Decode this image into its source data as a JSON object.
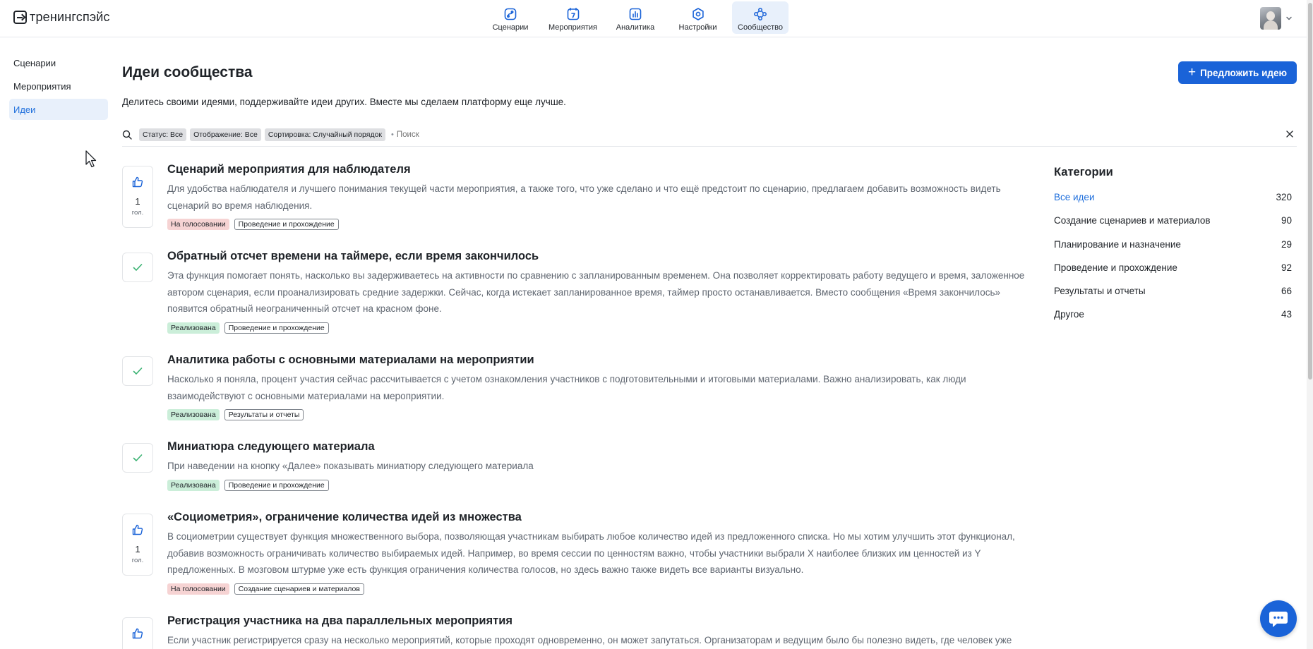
{
  "header": {
    "logo_text": "тренингспэйс",
    "nav": [
      {
        "label": "Сценарии",
        "icon": "scenario-icon"
      },
      {
        "label": "Мероприятия",
        "icon": "calendar-icon"
      },
      {
        "label": "Аналитика",
        "icon": "analytics-icon"
      },
      {
        "label": "Настройки",
        "icon": "settings-icon"
      },
      {
        "label": "Сообщество",
        "icon": "community-icon",
        "active": true
      }
    ]
  },
  "sidebar": {
    "items": [
      {
        "label": "Сценарии"
      },
      {
        "label": "Мероприятия"
      },
      {
        "label": "Идеи",
        "active": true
      }
    ]
  },
  "main": {
    "title": "Идеи сообщества",
    "subtitle": "Делитесь своими идеями, поддерживайте идеи других. Вместе мы сделаем платформу еще лучше.",
    "propose_button": "Предложить идею",
    "filters": {
      "chips": [
        "Статус: Все",
        "Отображение: Все",
        "Сортировка: Случайный порядок"
      ],
      "search_placeholder": "Поиск"
    },
    "ideas": [
      {
        "title": "Сценарий мероприятия для наблюдателя",
        "description": "Для удобства наблюдателя и лучшего понимания текущей части мероприятия, а также того, что уже сделано и что ещё предстоит по сценарию, предлагаем добавить возможность видеть сценарий во время наблюдения.",
        "status": "На голосовании",
        "category": "Проведение и прохождение",
        "votes": "1",
        "votes_unit": "гол."
      },
      {
        "title": "Обратный отсчет времени на таймере, если время закончилось",
        "description": "Эта функция помогает понять, насколько вы задерживаетесь на активности по сравнению с запланированным временем. Она позволяет корректировать работу ведущего и время, заложенное автором сценария, если проанализировать средние задержки. Сейчас, когда истекает запланированное время, таймер просто останавливается. Вместо сообщения «Время закончилось» появится обратный неограниченный отсчет на красном фоне.",
        "status": "Реализована",
        "category": "Проведение и прохождение"
      },
      {
        "title": "Аналитика работы с основными материалами на мероприятии",
        "description": "Насколько я поняла, процент участия сейчас рассчитывается с учетом ознакомления участников с подготовительными и итоговыми материалами. Важно анализировать, как люди взаимодействуют с основными материалами на мероприятии.",
        "status": "Реализована",
        "category": "Результаты и отчеты"
      },
      {
        "title": "Миниатюра следующего материала",
        "description": "При наведении на кнопку «Далее» показывать миниатюру следующего материала",
        "status": "Реализована",
        "category": "Проведение и прохождение"
      },
      {
        "title": "«Социометрия», ограничение количества идей из множества",
        "description": "В социометрии существует функция множественного выбора, позволяющая участникам выбирать любое количество идей из предложенного списка. Но мы хотим улучшить этот функционал, добавив возможность ограничивать количество выбираемых идей. Например, во время сессии по ценностям важно, чтобы участники выбрали X наиболее близких им ценностей из Y предложенных. В мозговом штурме уже есть функция ограничения количества голосов, но здесь важно также видеть все варианты визуально.",
        "status": "На голосовании",
        "category": "Создание сценариев и материалов",
        "votes": "1",
        "votes_unit": "гол."
      },
      {
        "title": "Регистрация участника на два параллельных мероприятия",
        "description": "Если участник регистрируется сразу на несколько мероприятий, которые проходят одновременно, он может запутаться. Организаторам и ведущим было бы полезно видеть, где человек уже"
      }
    ]
  },
  "categories": {
    "title": "Категории",
    "items": [
      {
        "name": "Все идеи",
        "count": "320",
        "active": true
      },
      {
        "name": "Создание сценариев и материалов",
        "count": "90"
      },
      {
        "name": "Планирование и назначение",
        "count": "29"
      },
      {
        "name": "Проведение и прохождение",
        "count": "92"
      },
      {
        "name": "Результаты и отчеты",
        "count": "66"
      },
      {
        "name": "Другое",
        "count": "43"
      }
    ]
  },
  "colors": {
    "accent": "#1a63d8",
    "active_bg": "#e8f0fb",
    "status_voting": "#f6d3d3",
    "status_done": "#cbeed9",
    "check": "#3bb273"
  }
}
